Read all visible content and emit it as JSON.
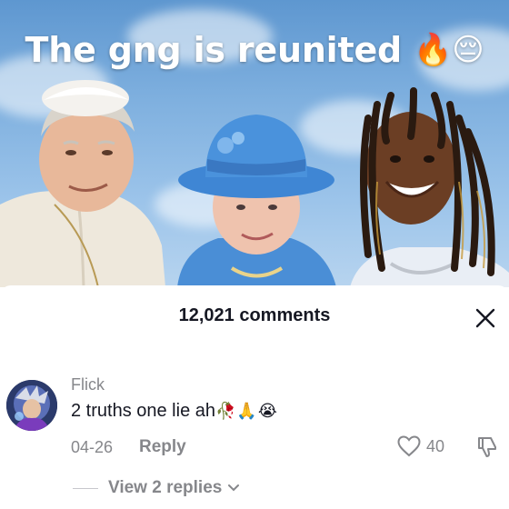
{
  "video": {
    "caption": "The gng is reunited",
    "caption_emojis": "🔥😔"
  },
  "comments_sheet": {
    "title": "12,021 comments",
    "close_icon": "close-icon"
  },
  "comment": {
    "username": "Flick",
    "text": "2 truths one lie ah",
    "text_emojis": "🥀🙏😭",
    "date": "04-26",
    "reply_label": "Reply",
    "like_count": "40",
    "view_replies_label": "View 2 replies"
  },
  "icons": {
    "like": "heart-outline-icon",
    "dislike": "thumbs-down-icon",
    "expand": "chevron-down-icon"
  },
  "colors": {
    "primary_text": "#161823",
    "secondary_text": "#86878b",
    "sky": "#7fb0df"
  }
}
